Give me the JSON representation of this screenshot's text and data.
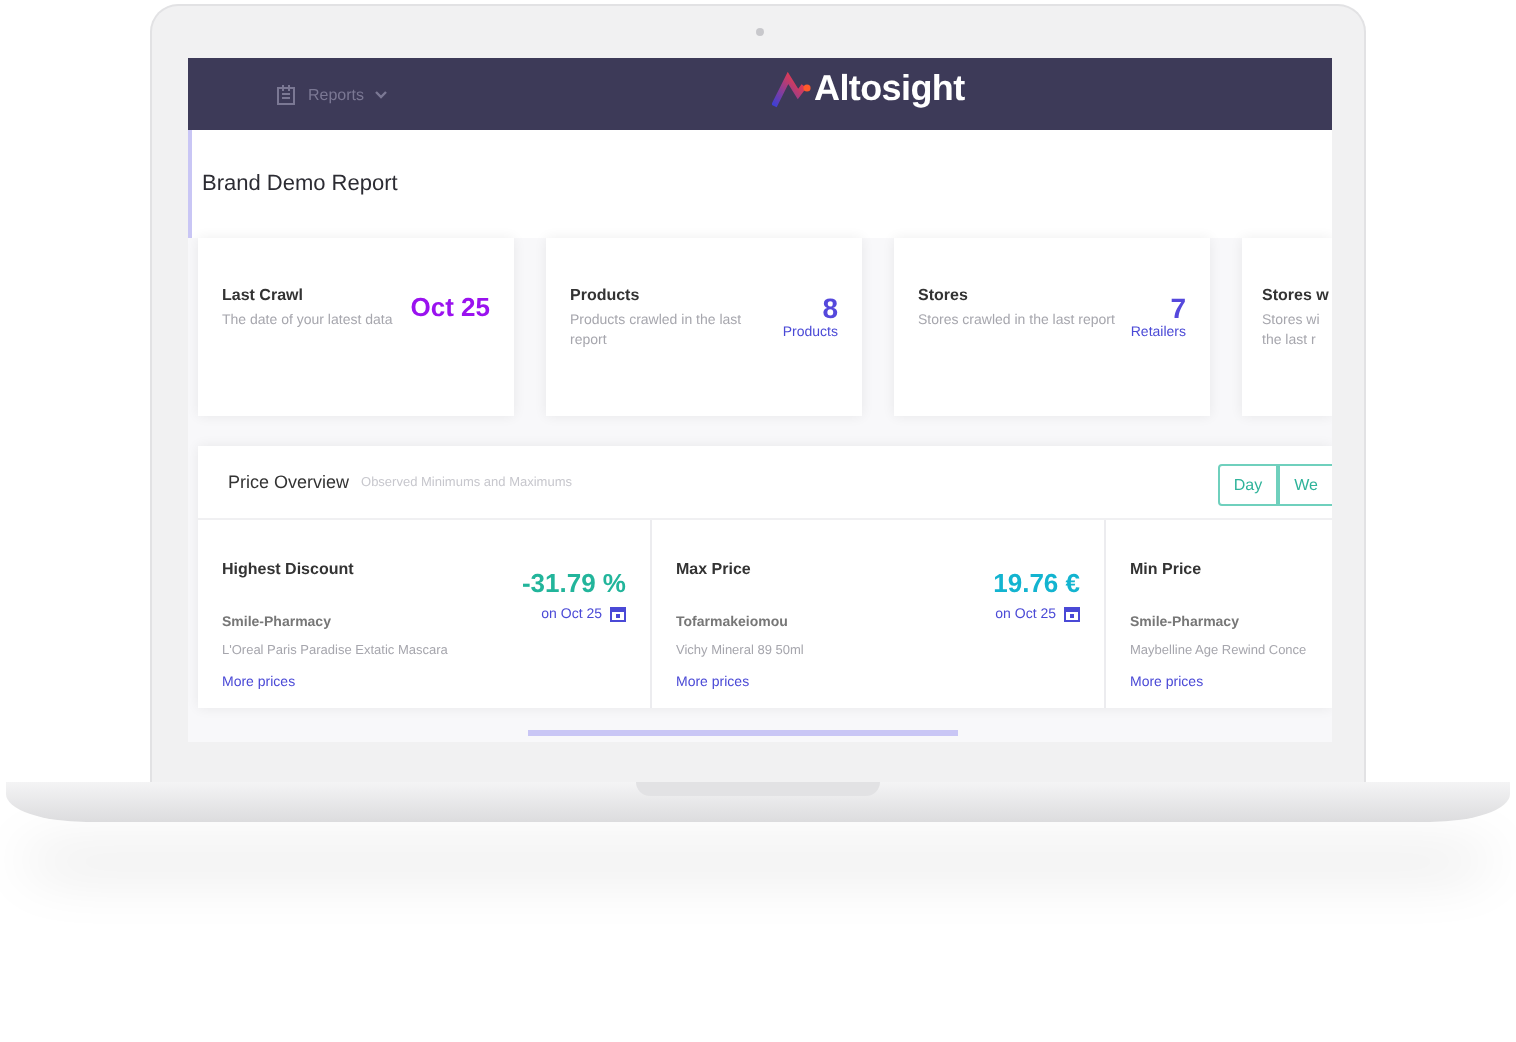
{
  "header": {
    "nav_label": "Reports",
    "logo": "Altosight"
  },
  "report_title": "Brand Demo Report",
  "stat_cards": [
    {
      "kind": "date",
      "title": "Last Crawl",
      "description": "The date of your latest data",
      "value": "Oct 25"
    },
    {
      "kind": "count",
      "title": "Products",
      "description": "Products crawled in the last report",
      "value": "8",
      "unit": "Products"
    },
    {
      "kind": "count",
      "title": "Stores",
      "description": "Stores crawled in the last report",
      "value": "7",
      "unit": "Retailers"
    },
    {
      "kind": "cut",
      "title": "Stores w",
      "description": "Stores wi\nthe last r"
    }
  ],
  "price_overview": {
    "title": "Price Overview",
    "subtitle": "Observed Minimums and Maximums",
    "periods": [
      {
        "label": "Day",
        "selected": false
      },
      {
        "label": "We",
        "selected": false
      }
    ],
    "cells": [
      {
        "title": "Highest Discount",
        "value": "-31.79 %",
        "color": "#22b59b",
        "date": "on Oct 25",
        "store": "Smile-Pharmacy",
        "product": "L'Oreal Paris Paradise Extatic Mascara",
        "link": "More prices"
      },
      {
        "title": "Max Price",
        "value": "19.76 €",
        "color": "#13b4d0",
        "date": "on Oct 25",
        "store": "Tofarmakeiomou",
        "product": "Vichy Mineral 89 50ml",
        "link": "More prices"
      },
      {
        "title": "Min Price",
        "store": "Smile-Pharmacy",
        "product": "Maybelline Age Rewind Conce",
        "link": "More prices"
      }
    ]
  }
}
